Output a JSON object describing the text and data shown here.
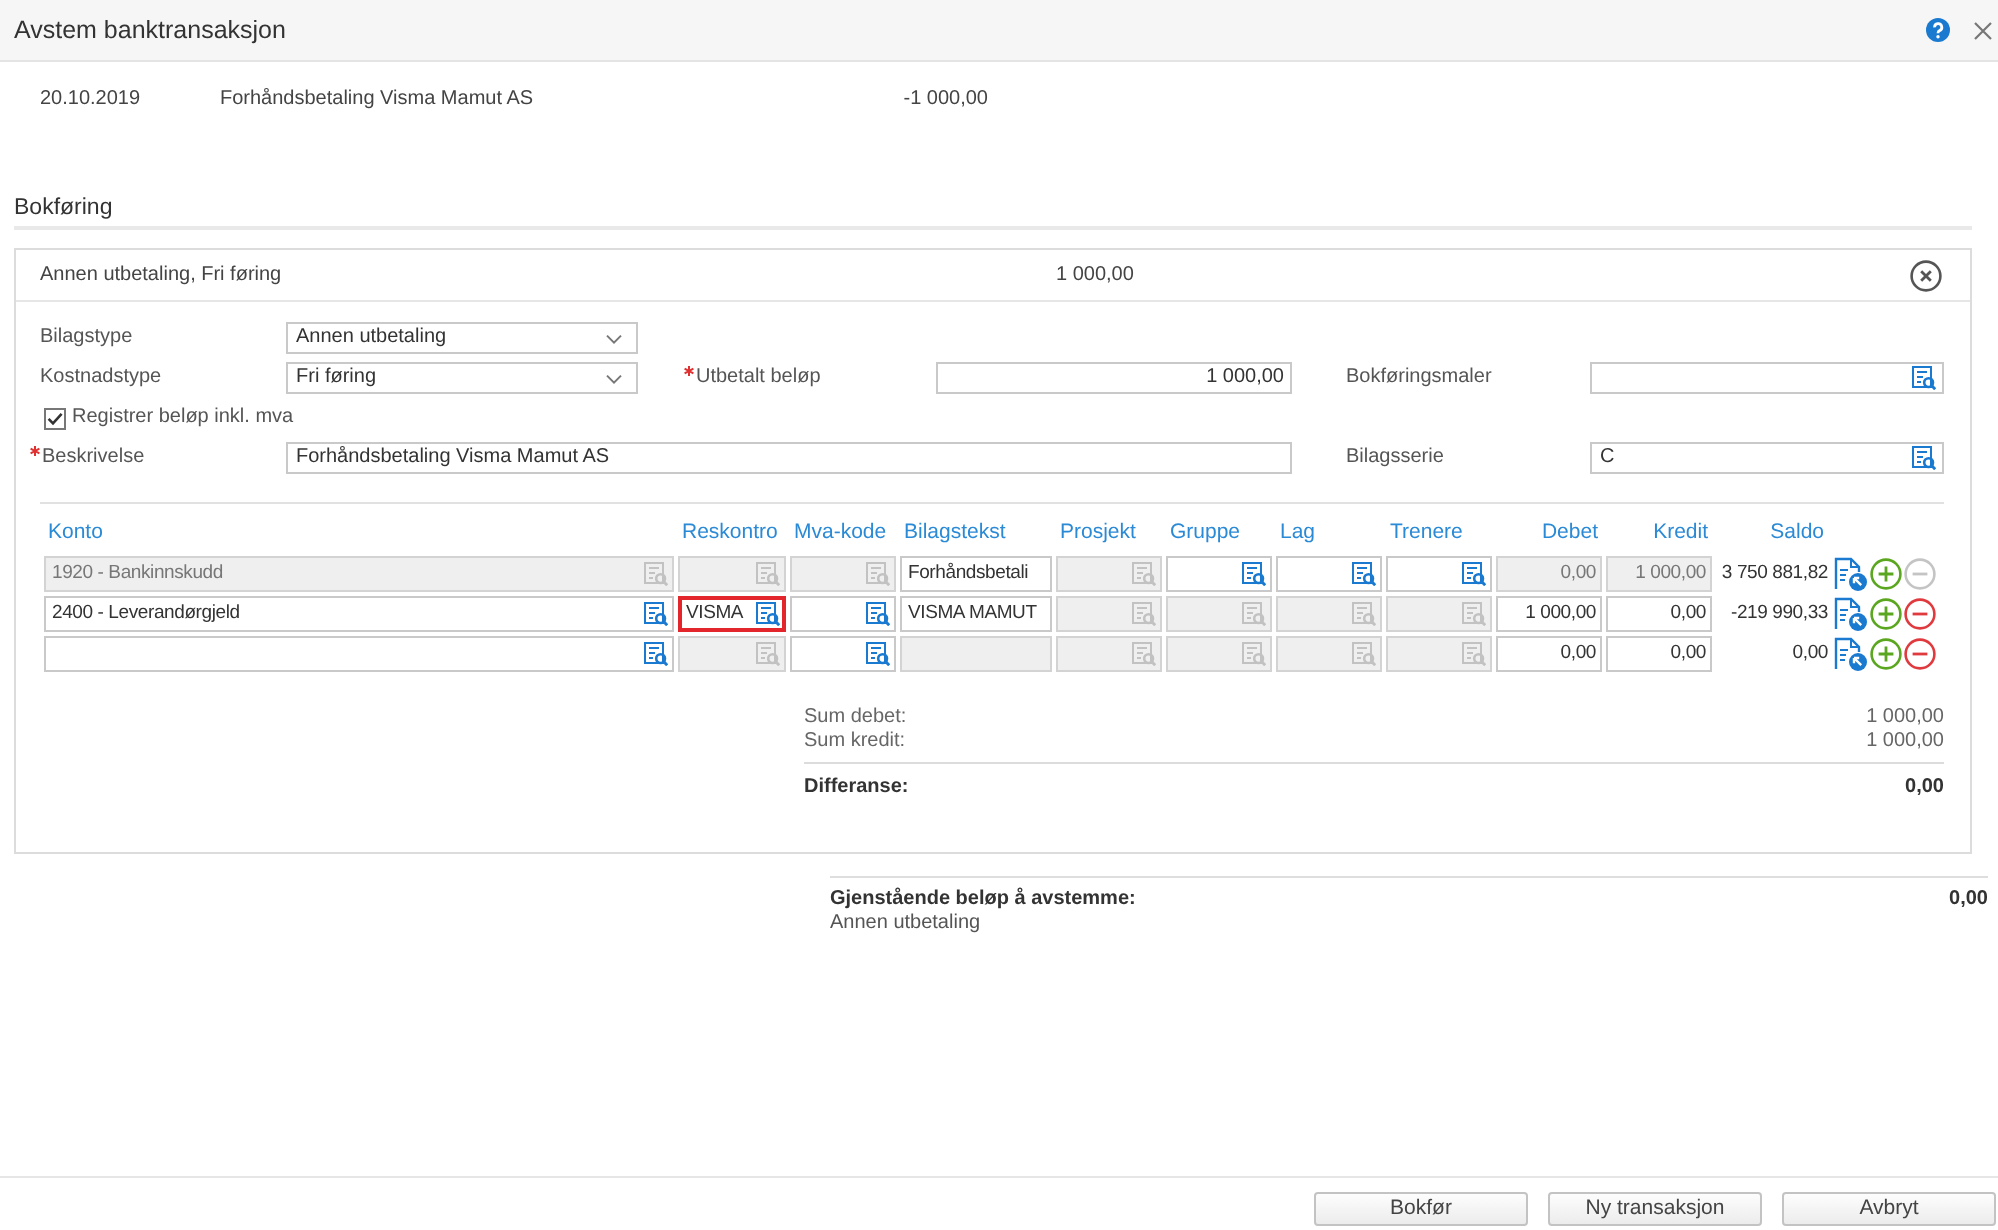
{
  "window": {
    "title": "Avstem banktransaksjon"
  },
  "transaction": {
    "date": "20.10.2019",
    "description": "Forhåndsbetaling Visma Mamut AS",
    "amount": "-1 000,00"
  },
  "section": {
    "title": "Bokføring"
  },
  "posting": {
    "summary": "Annen utbetaling, Fri føring",
    "amount": "1 000,00",
    "form_rows": [
      {
        "fields": [
          {
            "kind": "select",
            "label": "Bilagstype",
            "value": "Annen utbetaling",
            "required": false
          }
        ]
      },
      {
        "fields": [
          {
            "kind": "select",
            "label": "Kostnadstype",
            "value": "Fri føring",
            "required": false
          },
          {
            "kind": "amount",
            "label": "Utbetalt beløp",
            "value": "1 000,00",
            "required": true
          },
          {
            "kind": "lookup",
            "label": "Bokføringsmaler",
            "required": false
          }
        ]
      },
      {
        "fields": [
          {
            "kind": "checkbox",
            "label": "Registrer beløp inkl. mva",
            "checked": true
          }
        ]
      },
      {
        "fields": [
          {
            "kind": "text",
            "label": "Beskrivelse",
            "value": "Forhåndsbetaling Visma Mamut AS",
            "required": true
          },
          {
            "kind": "lookup",
            "label": "Bilagsserie",
            "value": "C",
            "required": false
          }
        ]
      }
    ],
    "table": {
      "columns": [
        {
          "label": "Konto",
          "kind": "lookup"
        },
        {
          "label": "Reskontro",
          "kind": "lookup"
        },
        {
          "label": "Mva-kode",
          "kind": "lookup"
        },
        {
          "label": "Bilagstekst",
          "kind": "text"
        },
        {
          "label": "Prosjekt",
          "kind": "lookup"
        },
        {
          "label": "Gruppe",
          "kind": "lookup"
        },
        {
          "label": "Lag",
          "kind": "lookup"
        },
        {
          "label": "Trenere",
          "kind": "lookup"
        },
        {
          "label": "Debet",
          "kind": "amount"
        },
        {
          "label": "Kredit",
          "kind": "amount"
        },
        {
          "label": "Saldo",
          "kind": "reading"
        }
      ],
      "rows": [
        {
          "cells": [
            {
              "value": "1920 - Bankinnskudd",
              "disabled": true,
              "invalid": false
            },
            {
              "disabled": true,
              "invalid": false
            },
            {
              "disabled": true,
              "invalid": false
            },
            {
              "value": "Forhåndsbetali",
              "disabled": false,
              "invalid": false
            },
            {
              "disabled": true,
              "invalid": false
            },
            {
              "disabled": false,
              "invalid": false
            },
            {
              "disabled": false,
              "invalid": false
            },
            {
              "disabled": false,
              "invalid": false
            },
            {
              "value": "0,00",
              "disabled": true,
              "invalid": false
            },
            {
              "value": "1 000,00",
              "disabled": true,
              "invalid": false
            }
          ],
          "saldo": "3 750 881,82",
          "can_remove": false
        },
        {
          "cells": [
            {
              "value": "2400 - Leverandørgjeld",
              "disabled": false,
              "invalid": false
            },
            {
              "value": "VISMA",
              "disabled": false,
              "invalid": true
            },
            {
              "disabled": false,
              "invalid": false
            },
            {
              "value": "VISMA MAMUT",
              "disabled": false,
              "invalid": false
            },
            {
              "disabled": true,
              "invalid": false
            },
            {
              "disabled": true,
              "invalid": false
            },
            {
              "disabled": true,
              "invalid": false
            },
            {
              "disabled": true,
              "invalid": false
            },
            {
              "value": "1 000,00",
              "disabled": false,
              "invalid": false
            },
            {
              "value": "0,00",
              "disabled": false,
              "invalid": false
            }
          ],
          "saldo": "-219 990,33",
          "can_remove": true
        },
        {
          "cells": [
            {
              "disabled": false,
              "invalid": false
            },
            {
              "disabled": true,
              "invalid": false
            },
            {
              "disabled": false,
              "invalid": false
            },
            {
              "disabled": true,
              "invalid": false
            },
            {
              "disabled": true,
              "invalid": false
            },
            {
              "disabled": true,
              "invalid": false
            },
            {
              "disabled": true,
              "invalid": false
            },
            {
              "disabled": true,
              "invalid": false
            },
            {
              "value": "0,00",
              "disabled": false,
              "invalid": false
            },
            {
              "value": "0,00",
              "disabled": false,
              "invalid": false
            }
          ],
          "saldo": "0,00",
          "can_remove": true
        }
      ]
    },
    "totals": [
      {
        "kind": "sum",
        "label": "Sum debet:",
        "value": "1 000,00"
      },
      {
        "kind": "sum",
        "label": "Sum kredit:",
        "value": "1 000,00"
      },
      {
        "kind": "difference",
        "label": "Differanse:",
        "value": "0,00"
      }
    ]
  },
  "remaining": {
    "label": "Gjenstående beløp å avstemme:",
    "amount": "0,00",
    "note": "Annen utbetaling"
  },
  "buttons": [
    "Bokfør",
    "Ny transaksjon",
    "Avbryt"
  ]
}
